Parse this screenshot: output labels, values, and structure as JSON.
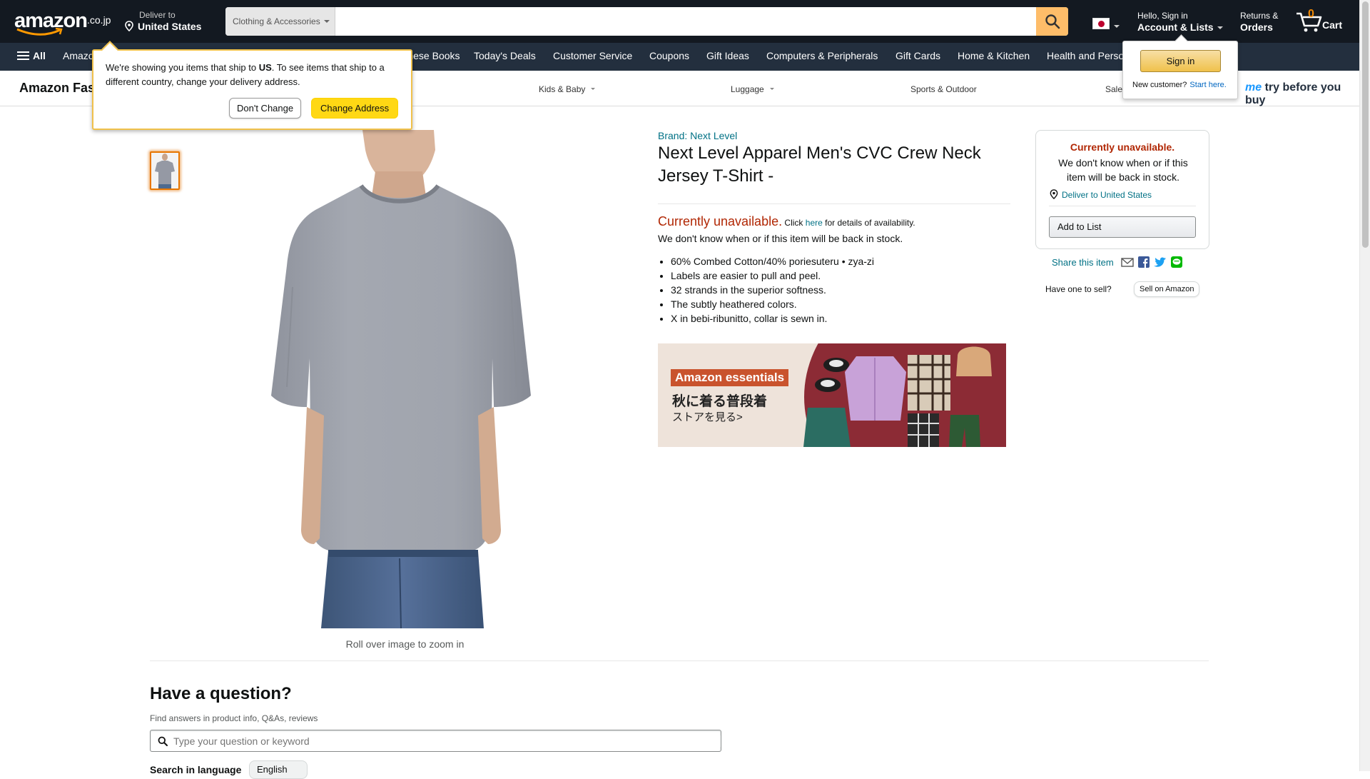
{
  "header": {
    "logo_word": "amazon",
    "logo_tld": ".co.jp",
    "deliver_line1": "Deliver to",
    "deliver_line2": "United States",
    "search_dept": "Clothing & Accessories",
    "search_placeholder": "",
    "account_line1": "Hello, Sign in",
    "account_line2": "Account & Lists",
    "returns_line1": "Returns &",
    "returns_line2": "Orders",
    "cart_count": "0",
    "cart_label": "Cart"
  },
  "nav": {
    "all_label": "All",
    "items": [
      "Amazon",
      "Japanese Books",
      "Today's Deals",
      "Customer Service",
      "Coupons",
      "Gift Ideas",
      "Computers & Peripherals",
      "Gift Cards",
      "Home & Kitchen",
      "Health and Personal Care"
    ]
  },
  "subnav": {
    "brand": "Amazon Fashion",
    "links": [
      "Kids & Baby",
      "Luggage",
      "Sports & Outdoor",
      "Sale"
    ],
    "try_prefix": "me",
    "try_text": " try before you buy"
  },
  "address_popover": {
    "msg_before": "We're showing you items that ship to ",
    "msg_bold": "US",
    "msg_after": ". To see items that ship to a different country, change your delivery address.",
    "dont_change": "Don't Change",
    "change_address": "Change Address"
  },
  "signin_popover": {
    "button": "Sign in",
    "new_customer": "New customer?",
    "start_here": "Start here."
  },
  "product": {
    "brand": "Brand: Next Level",
    "title": "Next Level Apparel Men's CVC Crew Neck Jersey T-Shirt -",
    "avail_big": "Currently unavailable.",
    "avail_click": " Click ",
    "avail_here": "here",
    "avail_rest": " for details of availability.",
    "avail_line2": "We don't know when or if this item will be back in stock.",
    "bullets": [
      "60% Combed Cotton/40% poriesuteru • zya-zi",
      "Labels are easier to pull and peel.",
      "32 strands in the superior softness.",
      "The subtly heathered colors.",
      "X in bebi-ribunitto, collar is sewn in."
    ],
    "zoom_hint": "Roll over image to zoom in",
    "banner_pill": "Amazon essentials",
    "banner_jp1": "秋に着る普段着",
    "banner_jp2": "ストアを見る>"
  },
  "buybox": {
    "unavailable": "Currently unavailable.",
    "message": "We don't know when or if this item will be back in stock.",
    "deliver": "Deliver to United States",
    "add_to_list": "Add to List",
    "share_label": "Share this item",
    "sell_question": "Have one to sell?",
    "sell_button": "Sell on Amazon"
  },
  "qa": {
    "title": "Have a question?",
    "subtitle": "Find answers in product info, Q&As, reviews",
    "placeholder": "Type your question or keyword",
    "lang_label": "Search in language",
    "lang_value": "English"
  },
  "colors": {
    "nav_dark": "#131921",
    "nav_mid": "#232f3e",
    "search_button": "#febd69",
    "accent_orange": "#ff9900",
    "price_red": "#b12704",
    "link_teal": "#007185"
  }
}
